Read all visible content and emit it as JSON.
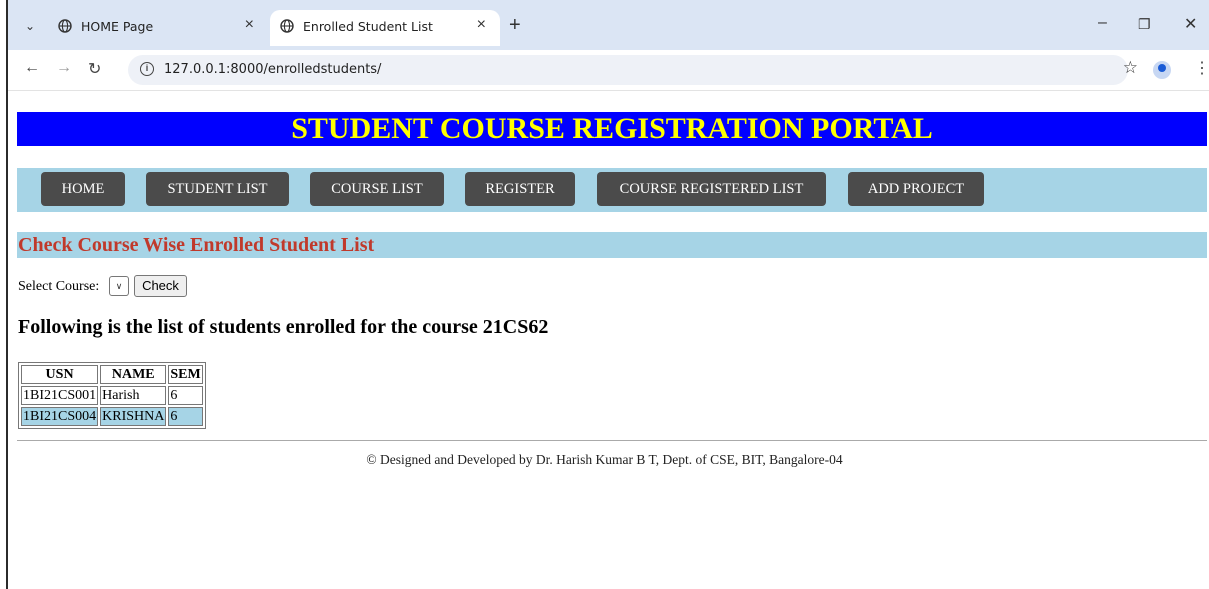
{
  "browser": {
    "tabs": [
      {
        "label": "HOME Page",
        "active": false
      },
      {
        "label": "Enrolled Student List",
        "active": true
      }
    ],
    "url": "127.0.0.1:8000/enrolledstudents/",
    "icons": {
      "tab_menu": "chevron-down-icon",
      "new_tab": "plus-icon",
      "back": "back-arrow-icon",
      "forward": "forward-arrow-icon",
      "reload": "reload-icon",
      "bookmark": "star-icon",
      "profile": "profile-icon",
      "menu": "kebab-menu-icon"
    }
  },
  "page": {
    "banner_title": "STUDENT COURSE REGISTRATION PORTAL",
    "nav": [
      "HOME",
      "STUDENT LIST",
      "COURSE LIST",
      "REGISTER",
      "COURSE REGISTERED LIST",
      "ADD PROJECT"
    ],
    "section_title": "Check Course Wise Enrolled Student List",
    "select_label": "Select Course:",
    "check_button": "Check",
    "list_heading": "Following is the list of students enrolled for the course 21CS62",
    "table": {
      "headers": [
        "USN",
        "NAME",
        "SEM"
      ],
      "rows": [
        [
          "1BI21CS001",
          "Harish",
          "6"
        ],
        [
          "1BI21CS004",
          "KRISHNA",
          "6"
        ]
      ]
    },
    "footer": "© Designed and Developed by Dr. Harish Kumar B T, Dept. of CSE, BIT, Bangalore-04"
  },
  "colors": {
    "banner_bg": "#0000ff",
    "banner_text": "#ffff00",
    "nav_bg": "#a6d4e6",
    "nav_button": "#4b4b4b",
    "section_title": "#c0392b"
  }
}
